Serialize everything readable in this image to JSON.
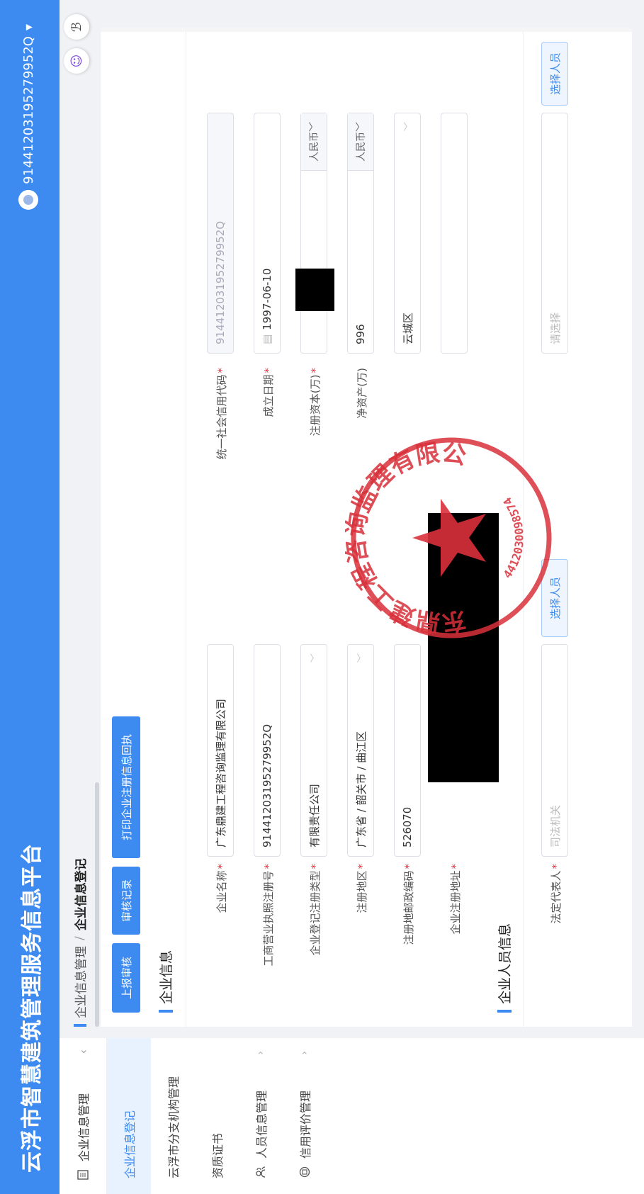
{
  "app": {
    "title": "云浮市智慧建筑管理服务信息平台",
    "user_id": "91441203195279952Q",
    "user_caret": "▾"
  },
  "sidebar": {
    "top_label": "企业信息管理",
    "top_chevron": "‹",
    "items": [
      {
        "label": "企业信息登记",
        "active": true,
        "icon": ""
      },
      {
        "label": "云浮市分支机构管理",
        "icon": ""
      },
      {
        "label": "资质证书",
        "icon": ""
      },
      {
        "label": "人员信息管理",
        "icon": "people-icon",
        "chevron": "›"
      },
      {
        "label": "信用评价管理",
        "icon": "record-icon",
        "chevron": "›"
      }
    ]
  },
  "breadcrumb": {
    "parent": "企业信息管理",
    "sep": "/",
    "current": "企业信息登记"
  },
  "buttons": {
    "submit": "上报审核",
    "review_record": "审核记录",
    "print": "打印企业注册信息回执"
  },
  "section_company": "企业信息",
  "section_people": "企业人员信息",
  "fields": {
    "company_name": {
      "label": "企业名称",
      "value": "广东鼎建工程咨询监理有限公司"
    },
    "credit_code": {
      "label": "统一社会信用代码",
      "value": "91441203195279952Q"
    },
    "biz_reg_no": {
      "label": "工商营业执照注册号",
      "value": "91441203195279952Q"
    },
    "found_date": {
      "label": "成立日期",
      "value": "1997-06-10",
      "icon": "calendar-icon"
    },
    "reg_type": {
      "label": "企业登记注册类型",
      "value": "有限责任公司"
    },
    "reg_capital": {
      "label": "注册资本(万)",
      "suffix": "人民币"
    },
    "reg_area": {
      "label": "注册地区",
      "value": "广东省 / 韶关市 / 曲江区"
    },
    "net_assets": {
      "label": "净资产(万)",
      "value": "996",
      "suffix": "人民币"
    },
    "postcode": {
      "label": "注册地邮政编码",
      "value": "526070"
    },
    "county": {
      "value": "云城区"
    },
    "address": {
      "label": "企业注册地址"
    },
    "legal_rep": {
      "label": "法定代表人",
      "placeholder": "司法机关",
      "button": "选择人员"
    },
    "tech_lead": {
      "placeholder": "请选择",
      "button": "选择人员"
    }
  },
  "seal": {
    "text": "广东鼎建工程咨询监理有限公司",
    "digits": "4412030098574",
    "color": "#d9303a"
  }
}
